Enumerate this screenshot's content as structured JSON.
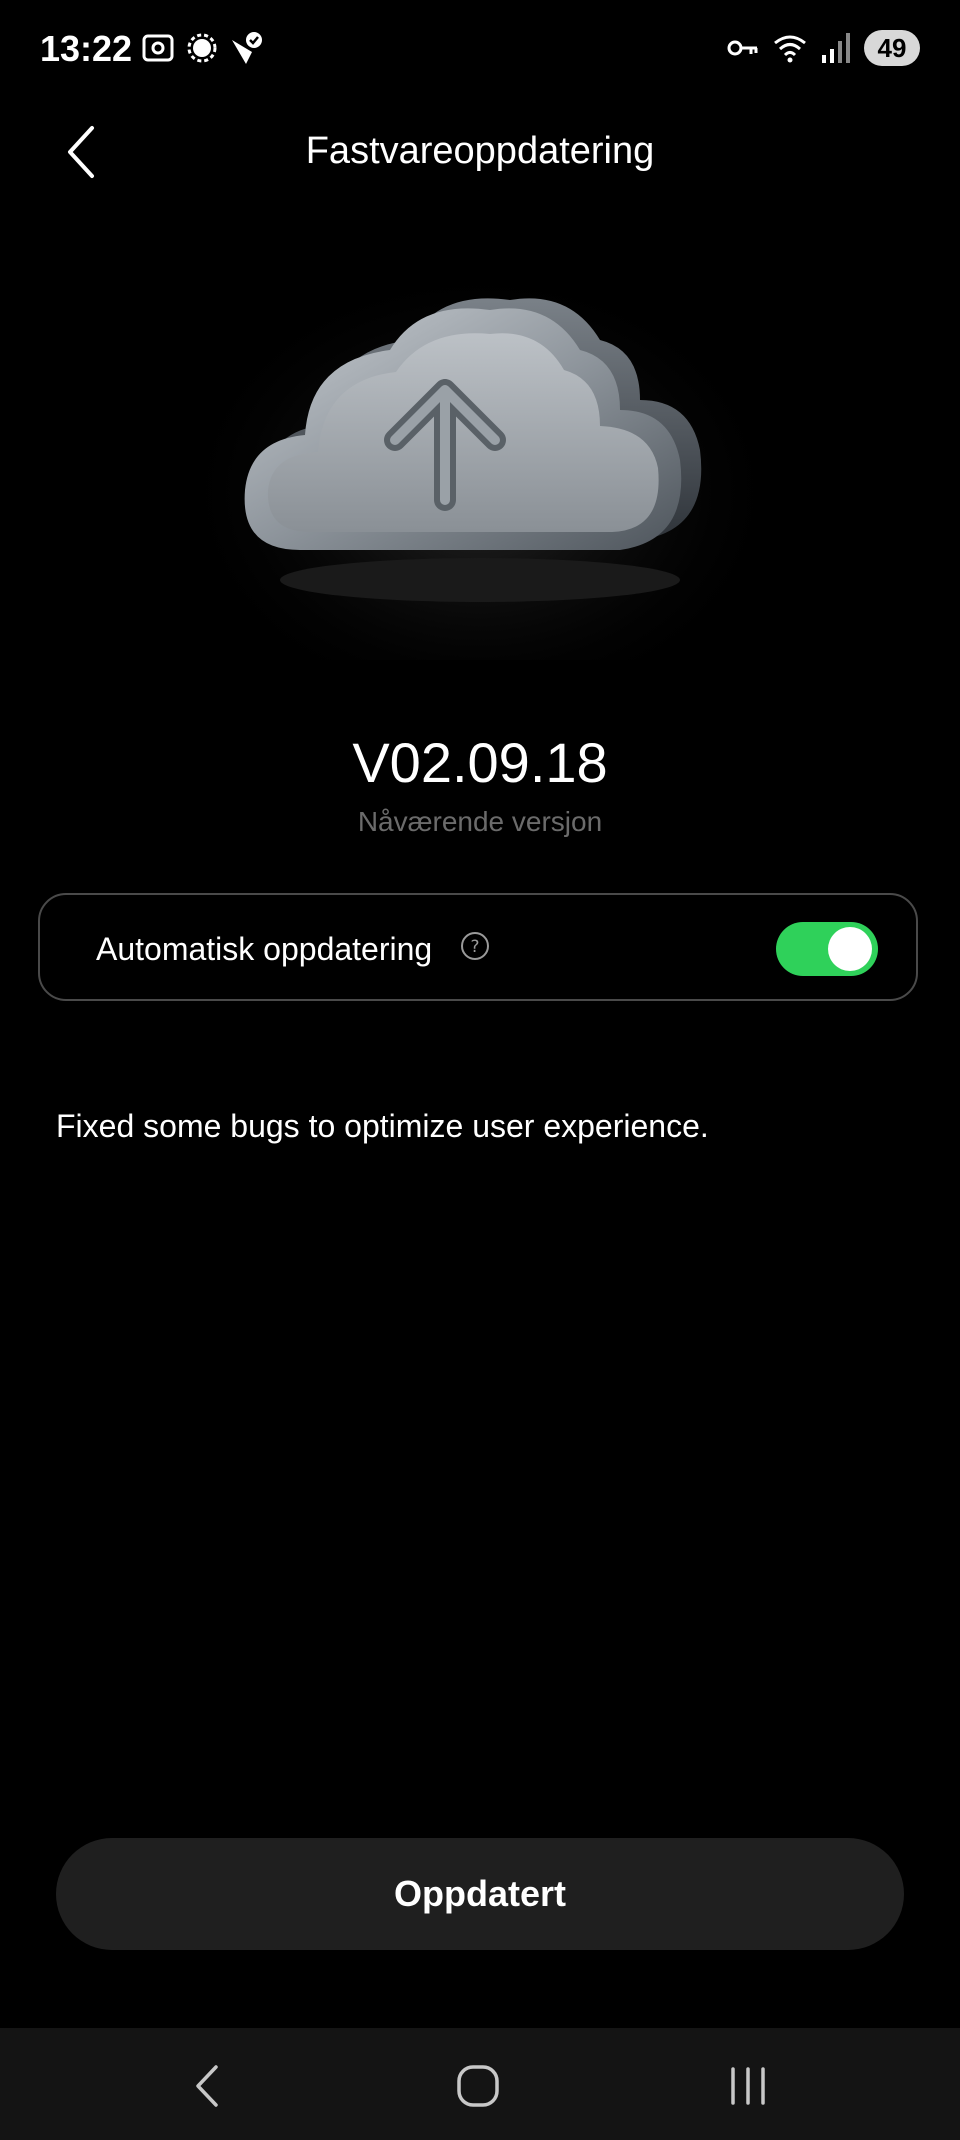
{
  "status_bar": {
    "time": "13:22",
    "battery": "49",
    "left_icons": [
      "screenshot-icon",
      "signal-messenger-icon",
      "check-shield-icon"
    ],
    "right_icons": [
      "vpn-key-icon",
      "wifi-icon",
      "cellular-signal-icon"
    ]
  },
  "header": {
    "title": "Fastvareoppdatering",
    "back_icon": "chevron-left-icon"
  },
  "hero": {
    "icon": "cloud-upload-icon"
  },
  "version": {
    "number": "V02.09.18",
    "caption": "Nåværende versjon"
  },
  "auto_update": {
    "label": "Automatisk oppdatering",
    "help_icon": "help-icon",
    "enabled": true,
    "accent_color": "#2fd15a"
  },
  "release_notes": "Fixed some bugs to optimize user experience.",
  "primary_button": {
    "label": "Oppdatert"
  },
  "navigation": {
    "items": [
      "back-nav-icon",
      "home-nav-icon",
      "recents-nav-icon"
    ]
  }
}
